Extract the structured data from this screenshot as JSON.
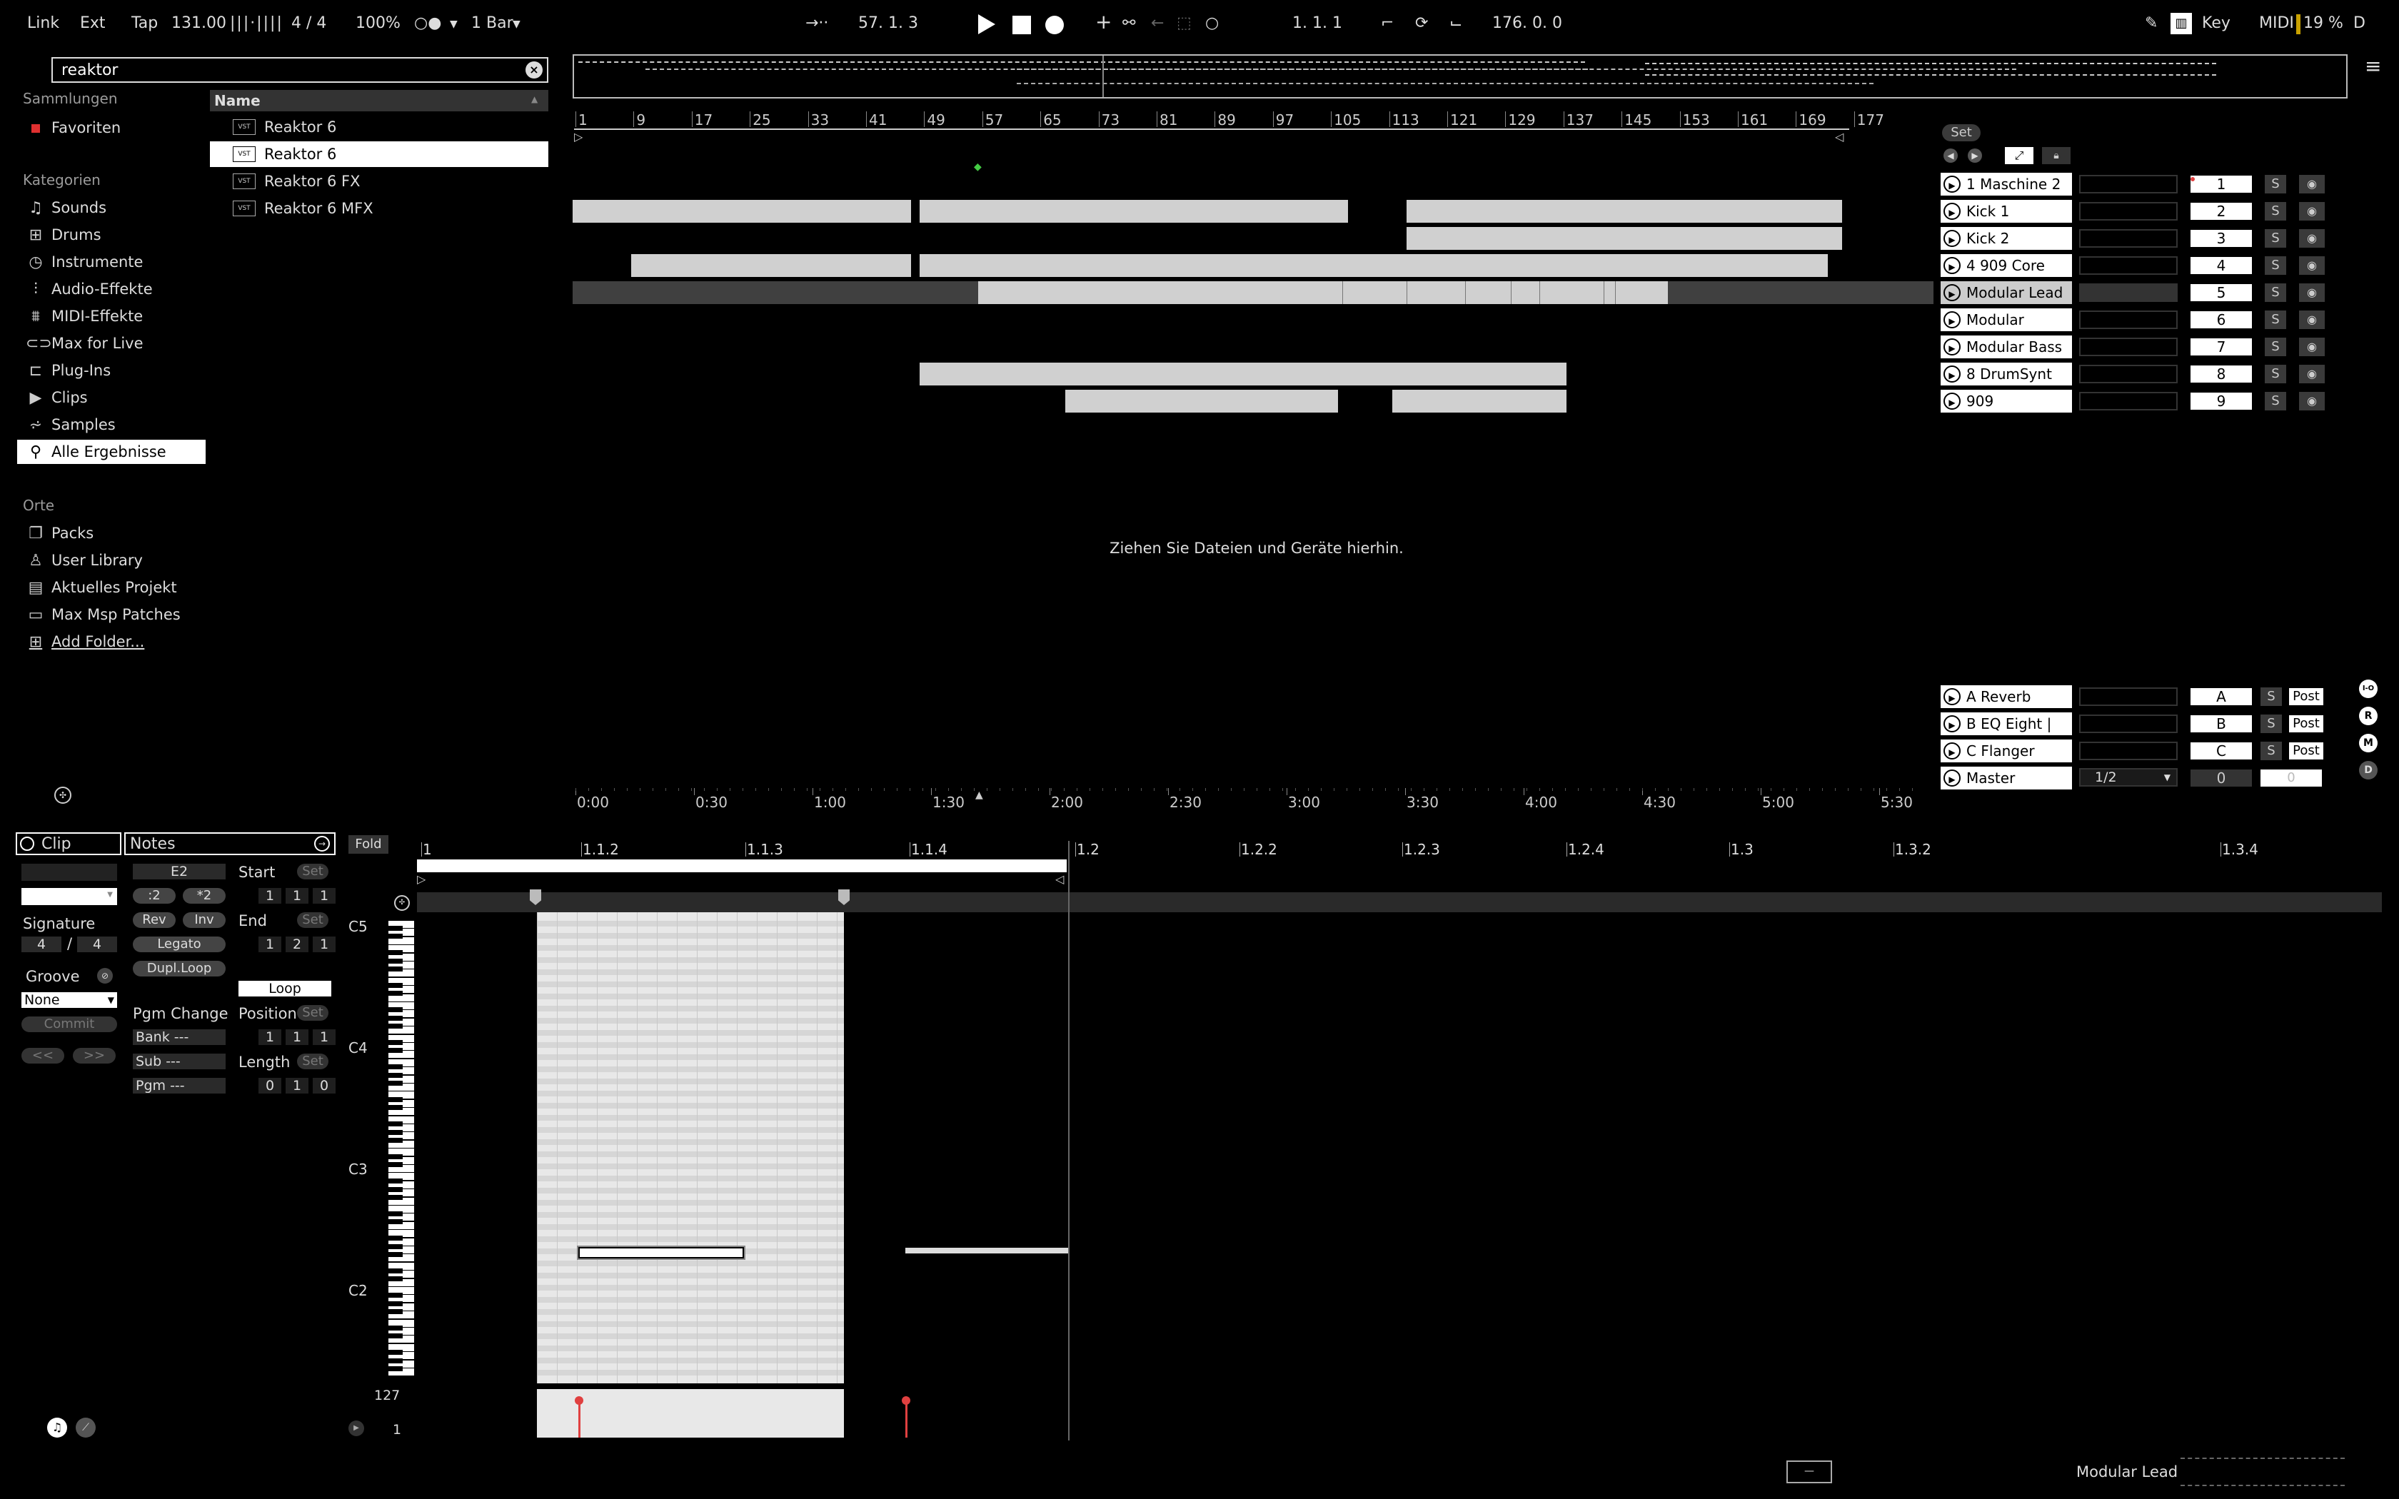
{
  "topbar": {
    "link": "Link",
    "ext": "Ext",
    "tap": "Tap",
    "tempo": "131.00",
    "signature": "4 / 4",
    "zoom": "100%",
    "quantize": "1 Bar",
    "position": "57.  1.  3",
    "loop_start": "1.  1.  1",
    "loop_length": "176.  0.  0",
    "key": "Key",
    "midi": "MIDI",
    "cpu": "19 %",
    "d": "D"
  },
  "browser": {
    "search_value": "reaktor",
    "collections_header": "Sammlungen",
    "favorites": "Favoriten",
    "categories_header": "Kategorien",
    "categories": [
      {
        "label": "Sounds",
        "icon": "sounds-icon",
        "glyph": "♫"
      },
      {
        "label": "Drums",
        "icon": "drums-icon",
        "glyph": "⊞"
      },
      {
        "label": "Instrumente",
        "icon": "instruments-icon",
        "glyph": "◷"
      },
      {
        "label": "Audio-Effekte",
        "icon": "audio-effects-icon",
        "glyph": "⫶"
      },
      {
        "label": "MIDI-Effekte",
        "icon": "midi-effects-icon",
        "glyph": "⩩"
      },
      {
        "label": "Max for Live",
        "icon": "max-for-live-icon",
        "glyph": "⊂⊃"
      },
      {
        "label": "Plug-Ins",
        "icon": "plugins-icon",
        "glyph": "⊏"
      },
      {
        "label": "Clips",
        "icon": "clips-icon",
        "glyph": "▶"
      },
      {
        "label": "Samples",
        "icon": "samples-icon",
        "glyph": "⩫"
      },
      {
        "label": "Alle Ergebnisse",
        "icon": "search-icon",
        "glyph": "⚲"
      }
    ],
    "places_header": "Orte",
    "places": [
      {
        "label": "Packs",
        "icon": "packs-icon",
        "glyph": "❐"
      },
      {
        "label": "User Library",
        "icon": "user-icon",
        "glyph": "♙"
      },
      {
        "label": "Aktuelles Projekt",
        "icon": "project-icon",
        "glyph": "▤"
      },
      {
        "label": "Max Msp Patches",
        "icon": "folder-icon",
        "glyph": "▭"
      },
      {
        "label": "Add Folder...",
        "icon": "add-folder-icon",
        "glyph": "⊞"
      }
    ],
    "results_header": "Name",
    "results": [
      "Reaktor 6",
      "Reaktor 6",
      "Reaktor 6 FX",
      "Reaktor 6 MFX"
    ],
    "plugin_badge": "VST"
  },
  "arrangement": {
    "bar_numbers": [
      "1",
      "9",
      "17",
      "25",
      "33",
      "41",
      "49",
      "57",
      "65",
      "73",
      "81",
      "89",
      "97",
      "105",
      "113",
      "121",
      "129",
      "137",
      "145",
      "153",
      "161",
      "169",
      "177"
    ],
    "time_labels": [
      "0:00",
      "0:30",
      "1:00",
      "1:30",
      "2:00",
      "2:30",
      "3:00",
      "3:30",
      "4:00",
      "4:30",
      "5:00",
      "5:30"
    ],
    "drop_hint": "Ziehen Sie Dateien und Geräte hierhin.",
    "set_button": "Set"
  },
  "mixer": {
    "tracks": [
      {
        "name": "1 Maschine 2",
        "num": "1"
      },
      {
        "name": "Kick 1",
        "num": "2"
      },
      {
        "name": "Kick 2",
        "num": "3"
      },
      {
        "name": "4 909 Core",
        "num": "4"
      },
      {
        "name": "Modular Lead",
        "num": "5"
      },
      {
        "name": "Modular",
        "num": "6"
      },
      {
        "name": "Modular Bass",
        "num": "7"
      },
      {
        "name": "8 DrumSynt",
        "num": "8"
      },
      {
        "name": "909",
        "num": "9"
      }
    ],
    "returns": [
      {
        "name": "A Reverb",
        "num": "A"
      },
      {
        "name": "B EQ Eight |",
        "num": "B"
      },
      {
        "name": "C Flanger",
        "num": "C"
      }
    ],
    "master": {
      "name": "Master",
      "cue": "1/2",
      "num": "0"
    },
    "solo": "S",
    "post": "Post",
    "side_buttons": [
      "I-O",
      "R",
      "M",
      "D"
    ]
  },
  "clip_panel": {
    "clip_tab": "Clip",
    "notes_tab": "Notes",
    "signature_label": "Signature",
    "sig_num": "4",
    "sig_den": "4",
    "groove_label": "Groove",
    "groove_value": "None",
    "commit": "Commit",
    "nav_prev": "<<",
    "nav_next": ">>",
    "note_value": "E2",
    "div2": ":2",
    "mul2": "*2",
    "rev": "Rev",
    "inv": "Inv",
    "legato": "Legato",
    "dupl_loop": "Dupl.Loop",
    "pgm_change": "Pgm Change",
    "bank": "Bank ---",
    "sub": "Sub ---",
    "pgm": "Pgm ---",
    "start_label": "Start",
    "end_label": "End",
    "set": "Set",
    "start_vals": [
      "1",
      "1",
      "1"
    ],
    "end_vals": [
      "1",
      "2",
      "1"
    ],
    "loop": "Loop",
    "position_label": "Position",
    "length_label": "Length",
    "position_vals": [
      "1",
      "1",
      "1"
    ],
    "length_vals": [
      "0",
      "1",
      "0"
    ],
    "fold": "Fold"
  },
  "editor": {
    "ruler": [
      "1",
      "1.1.2",
      "1.1.3",
      "1.1.4",
      "1.2",
      "1.2.2",
      "1.2.3",
      "1.2.4",
      "1.3",
      "1.3.2",
      "1.3.4"
    ],
    "note_labels": [
      "C5",
      "C4",
      "C3",
      "C2"
    ],
    "vel_max": "127",
    "vel_min": "1"
  },
  "statusbar": {
    "track": "Modular Lead"
  },
  "colors": {
    "background": "#000000",
    "clip": "#d0d0d0",
    "selected": "#ffffff",
    "accent_red": "#e04040",
    "text": "#dddddd"
  }
}
